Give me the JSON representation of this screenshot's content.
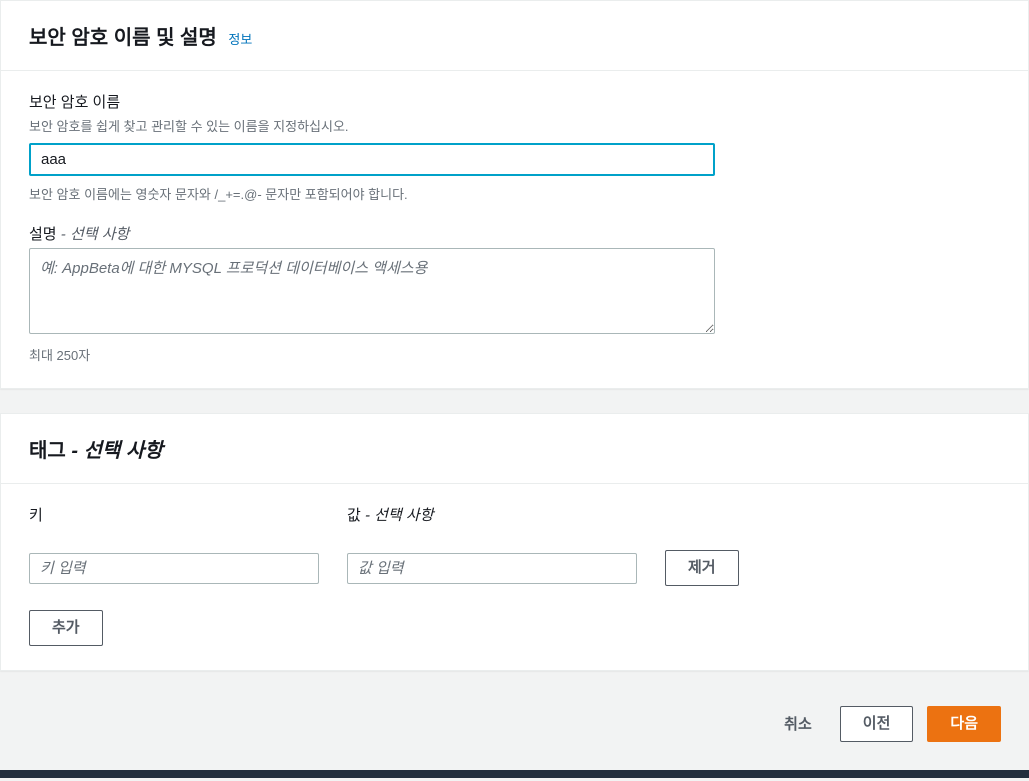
{
  "section1": {
    "title": "보안 암호 이름 및 설명",
    "info_link": "정보",
    "name": {
      "label": "보안 암호 이름",
      "hint": "보안 암호를 쉽게 찾고 관리할 수 있는 이름을 지정하십시오.",
      "value": "aaa",
      "constraint": "보안 암호 이름에는 영숫자 문자와 /_+=.@- 문자만 포함되어야 합니다."
    },
    "description": {
      "label": "설명",
      "optional": "- 선택 사항",
      "value": "",
      "placeholder": "예: AppBeta에 대한 MYSQL 프로덕션 데이터베이스 액세스용",
      "constraint": "최대 250자"
    }
  },
  "section2": {
    "title": "태그",
    "optional_suffix": "- 선택 사항",
    "key_label": "키",
    "value_label": "값",
    "value_optional": "- 선택 사항",
    "key_placeholder": "키 입력",
    "value_placeholder": "값 입력",
    "remove_label": "제거",
    "add_label": "추가"
  },
  "footer": {
    "cancel": "취소",
    "previous": "이전",
    "next": "다음"
  }
}
